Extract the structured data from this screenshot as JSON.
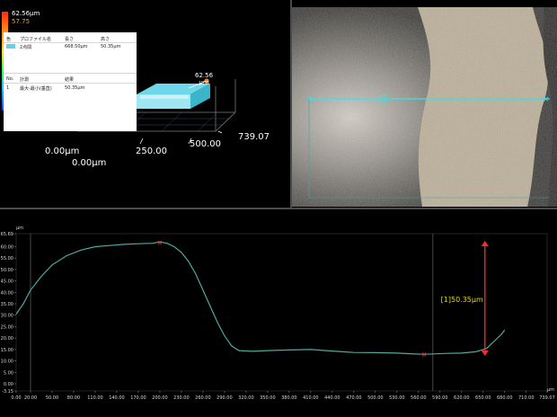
{
  "scale": {
    "top_value": "62.56μm",
    "mid_value": "57.75",
    "colors": [
      "#ff2a1a",
      "#ff9a1a",
      "#ffe81a",
      "#3dff4a",
      "#17c8ff",
      "#2a3cff"
    ]
  },
  "table": {
    "headers": {
      "color": "色",
      "profile_name": "プロファイル名",
      "length": "長さ",
      "height": "高さ"
    },
    "row": {
      "name": "2点間",
      "length": "668.50μm",
      "height": "50.35μm",
      "color": "#5fd3ec"
    },
    "headers2": {
      "no": "No.",
      "measure": "計測",
      "result": "結果"
    },
    "row2": {
      "no": "1",
      "measure": "最大-最小(垂直)",
      "result": "50.35μm"
    }
  },
  "view3d": {
    "peak_label_value": "62.56",
    "peak_label_unit": "μm",
    "axis_labels": [
      "0.00μm",
      "0.00μm",
      "250.00",
      "500.00",
      "739.07"
    ]
  },
  "chart_data": {
    "type": "line",
    "x_unit": "μm",
    "y_unit": "μm",
    "xlim": [
      0.0,
      739.07
    ],
    "ylim": [
      -3.15,
      65.69
    ],
    "x_ticks": [
      "0.00",
      "20.00",
      "50.00",
      "80.00",
      "110.00",
      "140.00",
      "170.00",
      "200.00",
      "230.00",
      "260.00",
      "290.00",
      "320.00",
      "350.00",
      "380.00",
      "410.00",
      "440.00",
      "470.00",
      "500.00",
      "530.00",
      "560.00",
      "590.00",
      "620.00",
      "650.00",
      "680.00",
      "710.00",
      "739.07"
    ],
    "y_ticks": [
      "65.69",
      "60.00",
      "55.00",
      "50.00",
      "45.00",
      "40.00",
      "35.00",
      "30.00",
      "25.00",
      "20.00",
      "15.00",
      "10.00",
      "5.00",
      "0.00",
      "-3.15"
    ],
    "series": [
      {
        "color": "#4fa9a2",
        "x": [
          0,
          10,
          20,
          35,
          50,
          70,
          90,
          110,
          130,
          150,
          170,
          190,
          200,
          210,
          220,
          230,
          240,
          250,
          260,
          270,
          280,
          290,
          300,
          310,
          330,
          350,
          380,
          410,
          440,
          470,
          500,
          530,
          555,
          568,
          585,
          600,
          620,
          640,
          655,
          665,
          675,
          680
        ],
        "y": [
          30.5,
          35,
          41,
          47,
          52,
          56,
          58.5,
          60,
          60.5,
          61,
          61.3,
          61.5,
          62.1,
          61.5,
          60,
          57.5,
          53.5,
          48,
          41,
          34,
          27,
          21,
          16.5,
          14.5,
          14.2,
          14.5,
          14.8,
          15,
          14.3,
          13.7,
          13.6,
          13.4,
          13.0,
          12.9,
          13.1,
          13.3,
          13.4,
          14.0,
          15.5,
          18.5,
          21.5,
          23.5
        ]
      }
    ],
    "markers": [
      {
        "x": 200,
        "y": 62.05
      },
      {
        "x": 568,
        "y": 12.9
      }
    ],
    "cursor_lines_x": [
      20,
      580
    ],
    "dimension": {
      "x": 655,
      "y_top": 62.56,
      "y_bottom": 12.2,
      "label": "[1]50.35μm",
      "label_color": "#e8d31b",
      "arrow_color": "#ff2a2a"
    }
  }
}
